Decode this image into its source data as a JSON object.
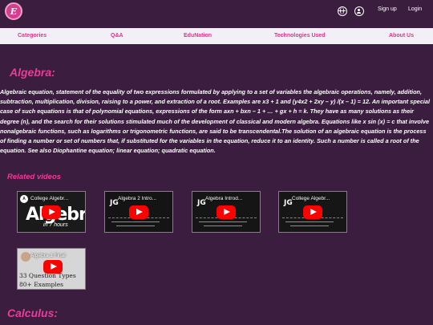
{
  "header": {
    "logo_letter": "E",
    "signup_label": "Sign up",
    "login_label": "Login"
  },
  "nav": {
    "items": [
      "Categories",
      "Q&A",
      "EduNation",
      "Technologies Used",
      "About Us"
    ]
  },
  "algebra": {
    "title": "Algebra:",
    "body": "Algebraic equation, statement of the equality of two expressions formulated by applying to a set of variables the algebraic operations, namely, addition, subtraction, multiplication, division, raising to a power, and extraction of a root. Examples are x3 + 1 and (y4x2 + 2xy – y) /(x – 1) = 12. An important special case of such equations is that of polynomial equations, expressions of the form axn + bxn – 1 + … + gx + h = k. They have as many solutions as their degree (n), and the search for their solutions stimulated much of the development of classical and modern algebra. Equations like x sin (x) = c that involve nonalgebraic functions, such as logarithms or trigonometric functions, are said to be transcendental.The solution of an algebraic equation is the process of finding a number or set of numbers that, if substituted for the variables in the equation, reduce it to an identity. Such a number is called a root of the equation. See also Diophantine equation; linear equation; quadratic equation."
  },
  "related": {
    "title": "Related videos",
    "videos": [
      {
        "title": "College Algebr...",
        "big_text": "Algebra",
        "sub_text": "in 7 hours",
        "channel": "A"
      },
      {
        "title": "Algebra 2 Intro...",
        "channel": "JG"
      },
      {
        "title": "Algebra Introd...",
        "channel": "JG"
      },
      {
        "title": "College Algebr...",
        "channel": "JG"
      },
      {
        "title": "Algebra 1 Final",
        "line1": "33 Question Types",
        "line2": "80+ Examples"
      }
    ]
  },
  "calculus": {
    "title": "Calculus:"
  },
  "colors": {
    "background": "#3b1d3f",
    "accent": "#e83d97",
    "nav_background": "#f3eff6",
    "play_button": "#ff0000"
  },
  "icons": {
    "globe": "globe-icon",
    "user": "user-icon",
    "play": "play-icon"
  }
}
